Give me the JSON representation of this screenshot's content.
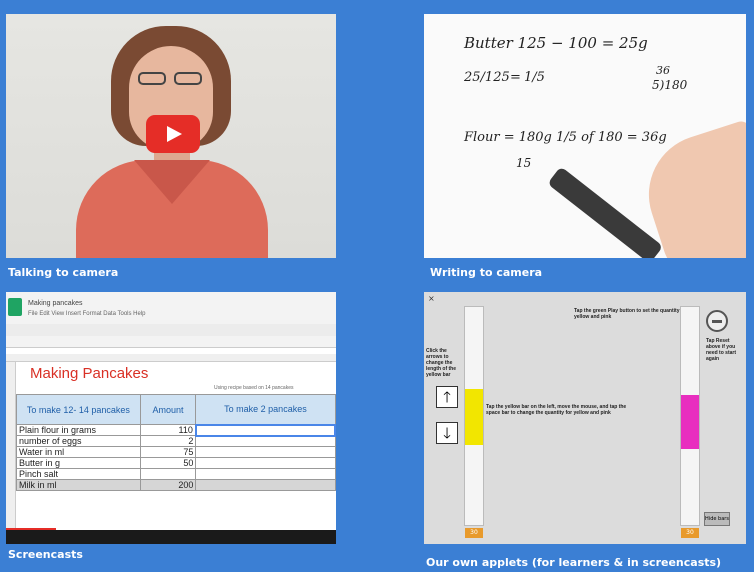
{
  "captions": {
    "talking": "Talking to camera",
    "writing": "Writing to camera",
    "screencasts": "Screencasts",
    "applets": "Our own applets (for learners & in screencasts)"
  },
  "whiteboard": {
    "line1": "Butter  125 − 100 = 25g",
    "frac_left": "25/125",
    "eq": "=",
    "frac_right": "1/5",
    "division": "5)180",
    "division_top": "36",
    "line3": "Flour = 180g   1/5 of 180 = 36g",
    "scribble": "15"
  },
  "spreadsheet": {
    "doc_title": "Making pancakes",
    "menu": "File  Edit  View  Insert  Format  Data  Tools  Help",
    "title": "Making Pancakes",
    "note": "Using recipe based on 14 pancakes",
    "headers": [
      "To make 12- 14 pancakes",
      "Amount",
      "To make 2 pancakes"
    ],
    "rows": [
      [
        "Plain flour in grams",
        "110",
        ""
      ],
      [
        "number of eggs",
        "2",
        ""
      ],
      [
        "Water in ml",
        "75",
        ""
      ],
      [
        "Butter in g",
        "50",
        ""
      ],
      [
        "Pinch salt",
        "",
        ""
      ],
      [
        "Milk in ml",
        "200",
        ""
      ]
    ]
  },
  "applet": {
    "instruction_left": "Click the arrows to change the length of the yellow bar",
    "instruction_top": "Tap the green Play button to set the quantity for yellow and pink",
    "instruction_center": "Tap the yellow bar on the left, move the mouse, and tap the space bar to change the quantity for yellow and pink",
    "instruction_right": "Tap Reset above if you need to start again",
    "up_arrow": "🡑",
    "down_arrow": "🡓",
    "small_button": "Hide bars",
    "left_tag": "30",
    "right_tag": "30",
    "close": "×",
    "yellow": "#f2e600",
    "pink": "#e82fbf"
  }
}
